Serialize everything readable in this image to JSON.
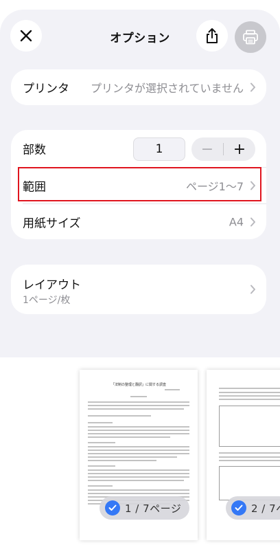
{
  "header": {
    "title": "オプション",
    "close_icon": "close-icon",
    "share_icon": "share-icon",
    "print_icon": "printer-icon"
  },
  "printer": {
    "label": "プリンタ",
    "value": "プリンタが選択されていません"
  },
  "settings": {
    "copies_label": "部数",
    "copies_value": "1",
    "stepper_minus": "−",
    "stepper_plus": "+",
    "range_label": "範囲",
    "range_value": "ページ1〜7",
    "paper_label": "用紙サイズ",
    "paper_value": "A4"
  },
  "layout": {
    "label": "レイアウト",
    "value": "1ページ/枚"
  },
  "preview": {
    "pages": [
      {
        "label": "1 / 7ページ",
        "selected": true,
        "doc_title": "「法制の整理と翻訳」に関する調査"
      },
      {
        "label": "2 / 7ペ",
        "selected": true
      }
    ]
  },
  "colors": {
    "accent": "#3478f6",
    "highlight": "#e0141e",
    "background": "#f2f2f7"
  }
}
